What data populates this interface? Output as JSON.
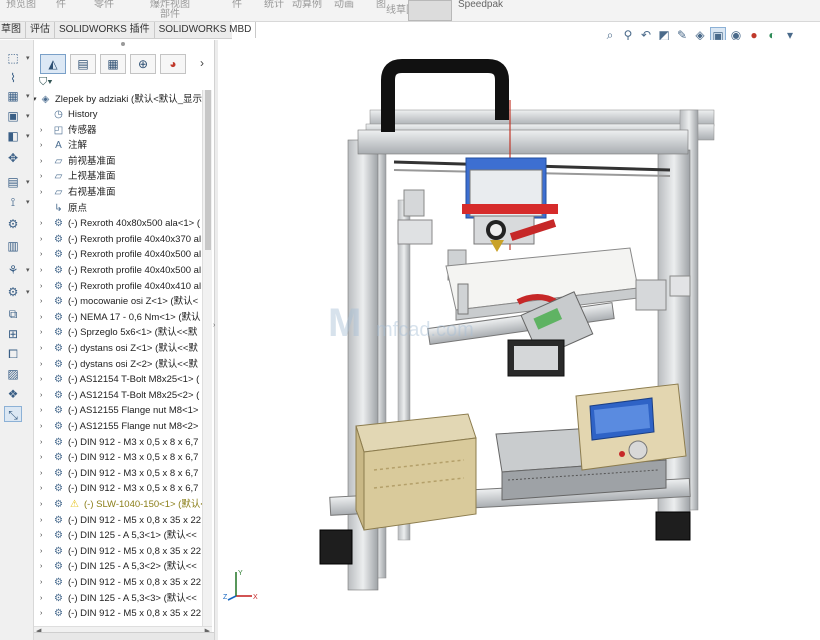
{
  "ribbon": {
    "items": [
      "预览图",
      "件",
      "零件",
      "爆炸视图",
      "部件",
      "件",
      "统计",
      "动算例",
      "动画",
      "图",
      "线草图",
      "Speedpak"
    ]
  },
  "tabs": [
    "草图",
    "评估",
    "SOLIDWORKS 插件",
    "SOLIDWORKS MBD"
  ],
  "tree": {
    "root": "Zlepek by adziaki  (默认<默认_显示状",
    "items": [
      {
        "label": "History",
        "icon": "history-icon"
      },
      {
        "label": "传感器",
        "icon": "sensor-icon"
      },
      {
        "label": "注解",
        "icon": "annotation-icon"
      },
      {
        "label": "前视基准面",
        "icon": "plane-icon"
      },
      {
        "label": "上视基准面",
        "icon": "plane-icon"
      },
      {
        "label": "右视基准面",
        "icon": "plane-icon"
      },
      {
        "label": "原点",
        "icon": "origin-icon"
      },
      {
        "label": "(-) Rexroth 40x80x500 ala<1> (",
        "icon": "component-icon"
      },
      {
        "label": "(-) Rexroth profile 40x40x370 al",
        "icon": "component-icon"
      },
      {
        "label": "(-) Rexroth profile 40x40x500 al",
        "icon": "component-icon"
      },
      {
        "label": "(-) Rexroth profile 40x40x500 al",
        "icon": "component-icon"
      },
      {
        "label": "(-) Rexroth profile 40x40x410 al",
        "icon": "component-icon"
      },
      {
        "label": "(-) mocowanie osi Z<1> (默认<",
        "icon": "component-icon"
      },
      {
        "label": "(-) NEMA 17 - 0,6 Nm<1> (默认",
        "icon": "component-icon"
      },
      {
        "label": "(-) Sprzeglo 5x6<1> (默认<<默",
        "icon": "component-icon"
      },
      {
        "label": "(-) dystans osi Z<1> (默认<<默",
        "icon": "component-icon"
      },
      {
        "label": "(-) dystans osi Z<2> (默认<<默",
        "icon": "component-icon"
      },
      {
        "label": "(-) AS12154 T-Bolt M8x25<1> (",
        "icon": "component-icon"
      },
      {
        "label": "(-) AS12154 T-Bolt M8x25<2> (",
        "icon": "component-icon"
      },
      {
        "label": "(-) AS12155 Flange nut M8<1>",
        "icon": "component-icon"
      },
      {
        "label": "(-) AS12155 Flange nut M8<2>",
        "icon": "component-icon"
      },
      {
        "label": "(-) DIN 912 - M3 x 0,5 x 8 x 6,7",
        "icon": "component-icon"
      },
      {
        "label": "(-) DIN 912 - M3 x 0,5 x 8 x 6,7",
        "icon": "component-icon"
      },
      {
        "label": "(-) DIN 912 - M3 x 0,5 x 8 x 6,7",
        "icon": "component-icon"
      },
      {
        "label": "(-) DIN 912 - M3 x 0,5 x 8 x 6,7",
        "icon": "component-icon"
      },
      {
        "label": "(-) SLW-1040-150<1> (默认<<",
        "icon": "warning-icon"
      },
      {
        "label": "(-) DIN 912 - M5 x 0,8 x 35 x 22",
        "icon": "component-icon"
      },
      {
        "label": "(-) DIN 125 - A 5,3<1> (默认<<",
        "icon": "component-icon"
      },
      {
        "label": "(-) DIN 912 - M5 x 0,8 x 35 x 22",
        "icon": "component-icon"
      },
      {
        "label": "(-) DIN 125 - A 5,3<2> (默认<<",
        "icon": "component-icon"
      },
      {
        "label": "(-) DIN 912 - M5 x 0,8 x 35 x 22",
        "icon": "component-icon"
      },
      {
        "label": "(-) DIN 125 - A 5,3<3> (默认<<",
        "icon": "component-icon"
      },
      {
        "label": "(-) DIN 912 - M5 x 0,8 x 35 x 22",
        "icon": "component-icon"
      }
    ]
  },
  "watermark": "mfcad.com",
  "triad": {
    "y": "Y",
    "z": "Z",
    "x": "X"
  },
  "colors": {
    "accent": "#2d5f8c",
    "warning": "#e6c218"
  }
}
